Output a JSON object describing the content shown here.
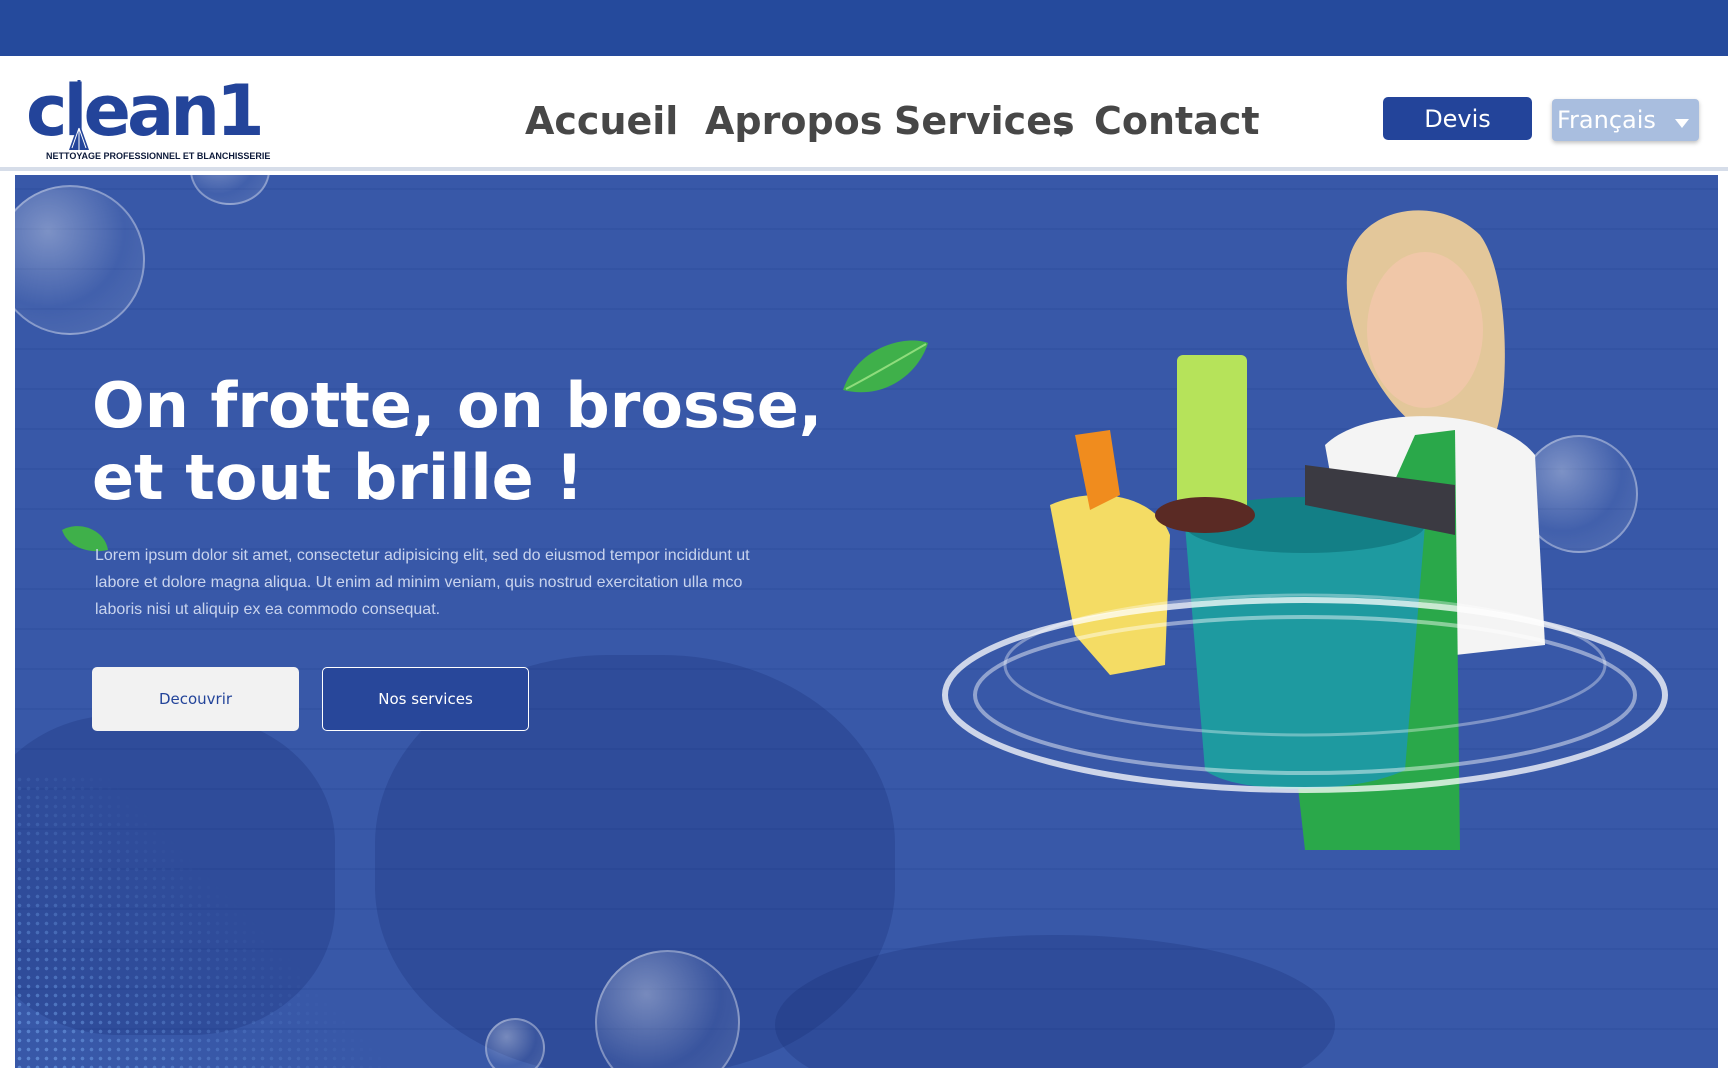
{
  "brand": {
    "name": "clean1",
    "tagline": "NETTOYAGE PROFESSIONNEL ET BLANCHISSERIE"
  },
  "nav": {
    "items": [
      {
        "label": "Accueil"
      },
      {
        "label": "Apropos"
      },
      {
        "label": "Services"
      },
      {
        "label": "Contact"
      }
    ],
    "devis_label": "Devis",
    "language": "Français"
  },
  "hero": {
    "headline": "On frotte, on brosse, et tout brille !",
    "body": "Lorem ipsum dolor sit amet, consectetur adipisicing elit, sed do eiusmod tempor incididunt ut labore et dolore magna aliqua. Ut enim ad minim veniam, quis nostrud exercitation ulla mco laboris nisi ut aliquip ex ea commodo consequat.",
    "btn_primary": "Decouvrir",
    "btn_secondary": "Nos services"
  },
  "colors": {
    "brand_blue": "#23449a",
    "hero_bg": "#3455a6",
    "leaf_green": "#3fb04a"
  },
  "icons": [
    "broom-icon",
    "chevron-down-icon",
    "leaf-icon",
    "bubble-icon"
  ]
}
